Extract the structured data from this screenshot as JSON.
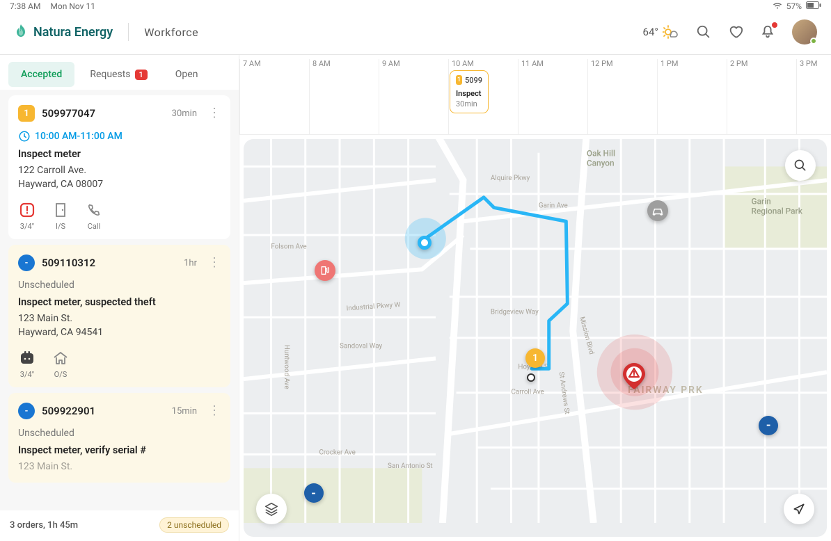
{
  "status": {
    "time": "7:38 AM",
    "date": "Mon Nov 11",
    "battery": "57%"
  },
  "header": {
    "brand": "Natura Energy",
    "section": "Workforce",
    "temp": "64°"
  },
  "tabs": {
    "accepted": "Accepted",
    "requests": "Requests",
    "requests_badge": "1",
    "open": "Open"
  },
  "orders": [
    {
      "badge": "1",
      "badge_style": "orange",
      "id": "509977047",
      "duration": "30min",
      "time": "10:00 AM-11:00 AM",
      "title": "Inspect meter",
      "addr1": "122 Carroll Ave.",
      "addr2": "Hayward, CA 08007",
      "meta": [
        {
          "icon": "alert",
          "label": "3/4\""
        },
        {
          "icon": "door",
          "label": "I/S"
        },
        {
          "icon": "phone",
          "label": "Call"
        }
      ]
    },
    {
      "badge": "-",
      "badge_style": "blue",
      "id": "509110312",
      "duration": "1hr",
      "unscheduled": "Unscheduled",
      "title": "Inspect meter, suspected theft",
      "addr1": "123 Main St.",
      "addr2": "Hayward, CA 94541",
      "meta": [
        {
          "icon": "robot",
          "label": "3/4\""
        },
        {
          "icon": "home",
          "label": "O/S"
        }
      ]
    },
    {
      "badge": "-",
      "badge_style": "blue",
      "id": "509922901",
      "duration": "15min",
      "unscheduled": "Unscheduled",
      "title": "Inspect meter, verify serial #",
      "addr1": "123 Main St.",
      "addr2": ""
    }
  ],
  "footer": {
    "summary": "3 orders, 1h 45m",
    "unscheduled": "2 unscheduled"
  },
  "timeline": {
    "hours": [
      "7 AM",
      "8 AM",
      "9 AM",
      "10 AM",
      "11 AM",
      "12 PM",
      "1 PM",
      "2 PM",
      "3 PM"
    ],
    "item": {
      "badge": "1",
      "id": "5099",
      "title": "Inspect",
      "dur": "30min"
    }
  },
  "map": {
    "labels": {
      "oak": "Oak Hill\nCanyon",
      "garin": "Garin\nRegional Park",
      "fairway": "FAIRWAY PRK"
    },
    "streets": {
      "industrial": "Industrial Pkwy W",
      "alquire": "Alquire Pkwy",
      "garin": "Garin Ave",
      "mission": "Mission Blvd",
      "huntwood": "Huntwood Ave",
      "folsom": "Folsom Ave",
      "sandoval": "Sandoval Way",
      "sanantonio": "San Antonio St",
      "crocker": "Crocker Ave",
      "hoylake": "Hoylake St",
      "carroll": "Carroll Ave",
      "standrews": "St Andrews St",
      "bridgeview": "Bridgeview Way"
    }
  }
}
